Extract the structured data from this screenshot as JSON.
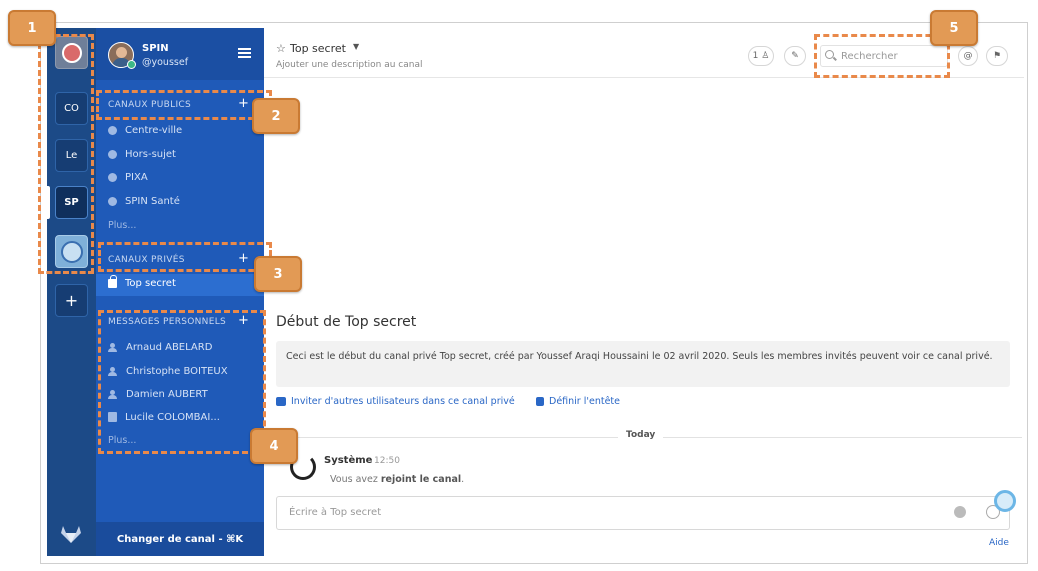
{
  "teams": [
    {
      "initials": "",
      "kind": "logo"
    },
    {
      "initials": "CO",
      "kind": "text"
    },
    {
      "initials": "Le",
      "kind": "text"
    },
    {
      "initials": "SP",
      "kind": "text",
      "active": true
    },
    {
      "initials": "",
      "kind": "image"
    }
  ],
  "team_add_label": "+",
  "sidebar": {
    "team_name": "SPIN",
    "username": "@youssef",
    "public_section": {
      "title": "CANAUX PUBLICS",
      "add": "+",
      "items": [
        "Centre-ville",
        "Hors-sujet",
        "PIXA",
        "SPIN Santé"
      ],
      "more": "Plus..."
    },
    "private_section": {
      "title": "CANAUX PRIVÉS",
      "add": "+",
      "items": [
        "Top secret"
      ]
    },
    "dm_section": {
      "title": "MESSAGES PERSONNELS",
      "add": "+",
      "items": [
        "Arnaud ABELARD",
        "Christophe BOITEUX",
        "Damien AUBERT",
        "Lucile COLOMBAI..."
      ],
      "more": "Plus..."
    },
    "switch_label": "Changer de canal - ⌘K"
  },
  "header": {
    "title": "Top secret",
    "description": "Ajouter une description au canal",
    "member_count": "1",
    "search_placeholder": "Rechercher"
  },
  "intro": {
    "title": "Début de Top secret",
    "text": "Ceci est le début du canal privé Top secret, créé par Youssef Araqi Houssaini le 02 avril 2020. Seuls les membres invités peuvent voir ce canal privé.",
    "invite_label": "Inviter d'autres utilisateurs dans ce canal privé",
    "header_label": "Définir l'entête"
  },
  "divider_label": "Today",
  "message": {
    "author": "Système",
    "time": "12:50",
    "text_before": "Vous avez ",
    "text_bold": "rejoint le canal",
    "text_after": "."
  },
  "compose_placeholder": "Écrire à Top secret",
  "help_label": "Aide",
  "callouts": [
    "1",
    "2",
    "3",
    "4",
    "5"
  ],
  "colors": {
    "team_bar": "#1c4a87",
    "sidebar": "#1f5ab8",
    "active_channel": "#2c6ed0",
    "link": "#2a67c6",
    "annotation": "#e9894a"
  }
}
